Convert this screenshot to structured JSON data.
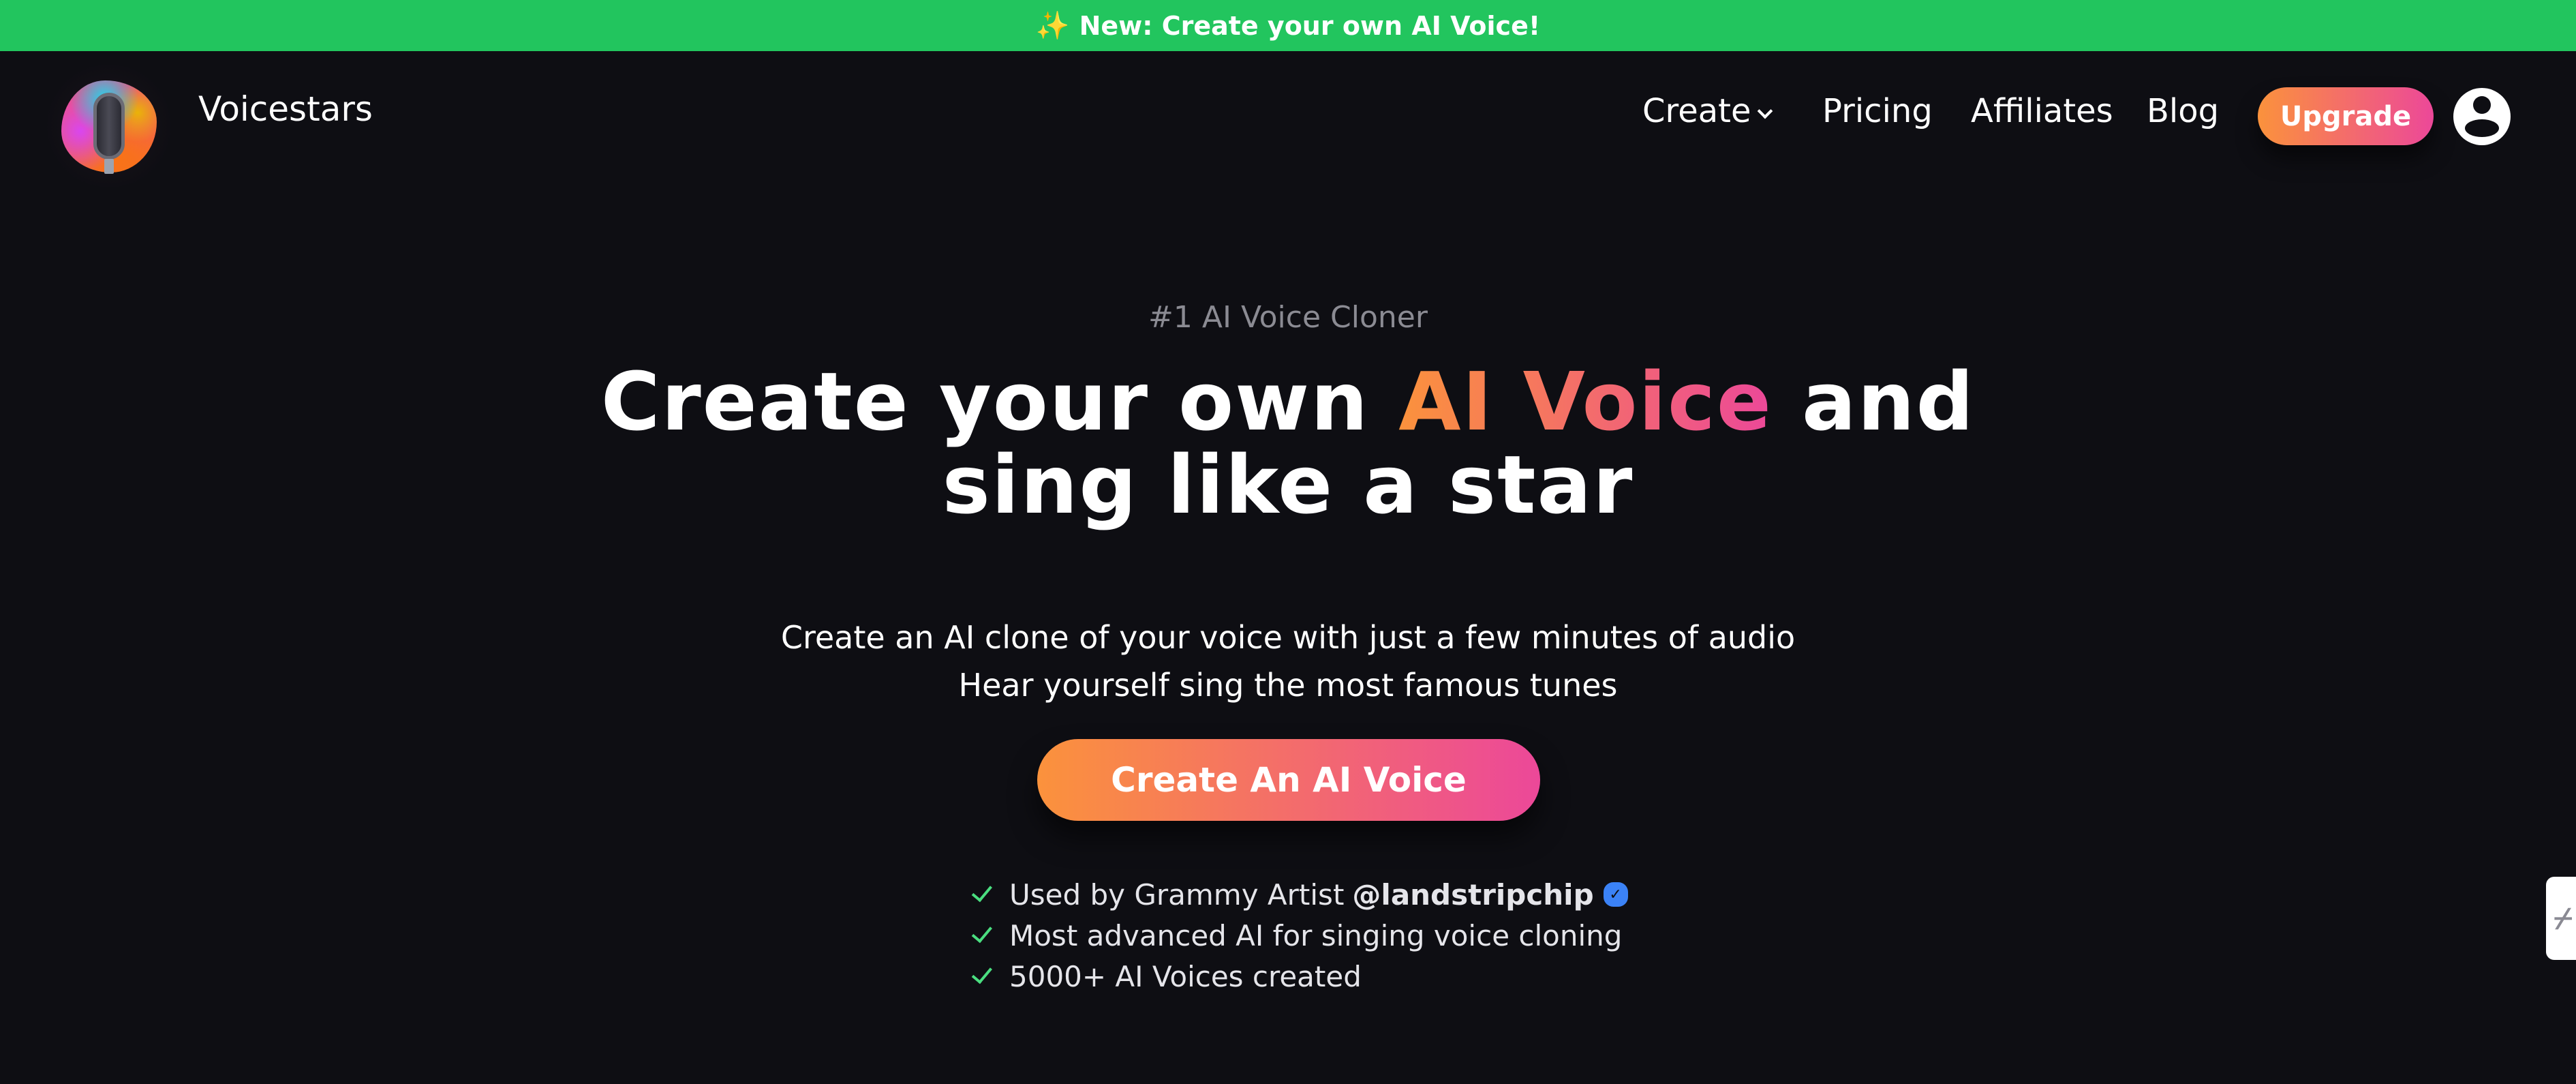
{
  "banner": {
    "icon": "sparkles-icon",
    "sparkle_glyph": "✨",
    "text": "New: Create your own AI Voice!",
    "color": "#22c55e"
  },
  "nav": {
    "brand": "Voicestars",
    "links": [
      {
        "label": "Create",
        "has_dropdown": true
      },
      {
        "label": "Pricing"
      },
      {
        "label": "Affiliates"
      },
      {
        "label": "Blog"
      }
    ],
    "upgrade_label": "Upgrade",
    "avatar_icon": "user-circle-icon"
  },
  "hero": {
    "eyebrow": "#1 AI Voice Cloner",
    "headline": {
      "before": "Create your own ",
      "highlight": "AI Voice",
      "after": " and",
      "line2": "sing like a star"
    },
    "subtitle_lines": [
      "Create an AI clone of your voice with just a few minutes of audio",
      "Hear yourself sing the most famous tunes"
    ],
    "cta_label": "Create An AI Voice",
    "features": [
      {
        "text": "Used by Grammy Artist ",
        "handle": "@landstripchip",
        "verified": true
      },
      {
        "text": "Most advanced AI for singing voice cloning"
      },
      {
        "text": "5000+ AI Voices created"
      }
    ]
  },
  "side_widget": {
    "glyph": "⌿"
  },
  "theme": {
    "background": "#0e0e13",
    "gradient_start": "#fb923c",
    "gradient_end": "#ec4899",
    "check_color": "#4ade80",
    "verified_color": "#3b82f6"
  }
}
